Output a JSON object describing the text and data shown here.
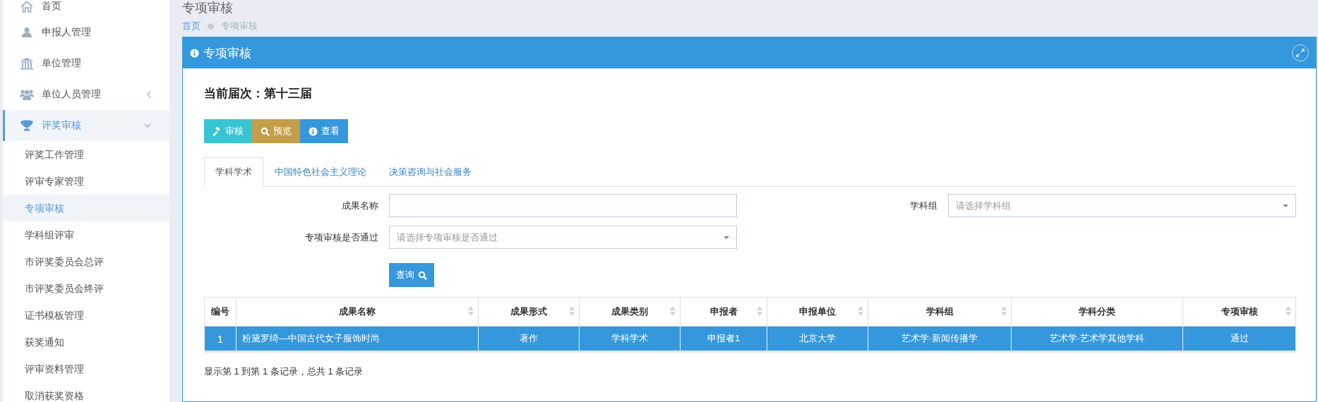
{
  "sidebar": {
    "items": [
      {
        "label": "首页",
        "selected": false
      },
      {
        "label": "申报人管理",
        "selected": false
      },
      {
        "label": "单位管理",
        "selected": false
      },
      {
        "label": "单位人员管理",
        "selected": false,
        "expanded": false
      },
      {
        "label": "评奖审核",
        "selected": true,
        "expanded": true,
        "children": [
          {
            "label": "评奖工作管理",
            "selected": false
          },
          {
            "label": "评审专家管理",
            "selected": false
          },
          {
            "label": "专项审核",
            "selected": true
          },
          {
            "label": "学科组评审",
            "selected": false
          },
          {
            "label": "市评奖委员会总评",
            "selected": false
          },
          {
            "label": "市评奖委员会终评",
            "selected": false
          },
          {
            "label": "证书模板管理",
            "selected": false
          },
          {
            "label": "获奖通知",
            "selected": false
          },
          {
            "label": "评审资料管理",
            "selected": false
          },
          {
            "label": "取消获奖资格",
            "selected": false
          }
        ]
      }
    ]
  },
  "page": {
    "title": "专项审核",
    "breadcrumb": [
      "首页",
      "专项审核"
    ]
  },
  "panel": {
    "title": "专项审核",
    "current_round": "当前届次：第十三届",
    "actions": [
      {
        "label": "审核",
        "color": "#36c6d3"
      },
      {
        "label": "预览",
        "color": "#c49f47"
      },
      {
        "label": "查看",
        "color": "#3598dc"
      }
    ],
    "tabs": [
      {
        "label": "学科学术",
        "selected": true
      },
      {
        "label": "中国特色社会主义理论",
        "selected": false
      },
      {
        "label": "决策咨询与社会服务",
        "selected": false
      }
    ],
    "filters": [
      [
        {
          "label": "成果名称",
          "kind": "text"
        },
        {
          "label": "学科组",
          "kind": "select",
          "placeholder": "请选择学科组"
        }
      ],
      [
        {
          "label": "专项审核是否通过",
          "kind": "select",
          "placeholder": "请选择专项审核是否通过"
        }
      ]
    ],
    "query_button": "查询",
    "table": {
      "columns": [
        {
          "label": "编号",
          "sortable": false
        },
        {
          "label": "成果名称",
          "sortable": true
        },
        {
          "label": "成果形式",
          "sortable": true
        },
        {
          "label": "成果类别",
          "sortable": true
        },
        {
          "label": "申报者",
          "sortable": true
        },
        {
          "label": "申报单位",
          "sortable": true
        },
        {
          "label": "学科组",
          "sortable": true
        },
        {
          "label": "学科分类",
          "sortable": false
        },
        {
          "label": "专项审核",
          "sortable": true
        }
      ],
      "rows": [
        {
          "selected": true,
          "cells": [
            "1",
            "粉黛罗绮—中国古代女子服饰时尚",
            "著作",
            "学科学术",
            "申报者1",
            "北京大学",
            "艺术学·新闻传播学",
            "艺术学·艺术学其他学科",
            "通过"
          ]
        }
      ]
    },
    "footer": "显示第 1 到第 1 条记录，总共 1 条记录"
  }
}
